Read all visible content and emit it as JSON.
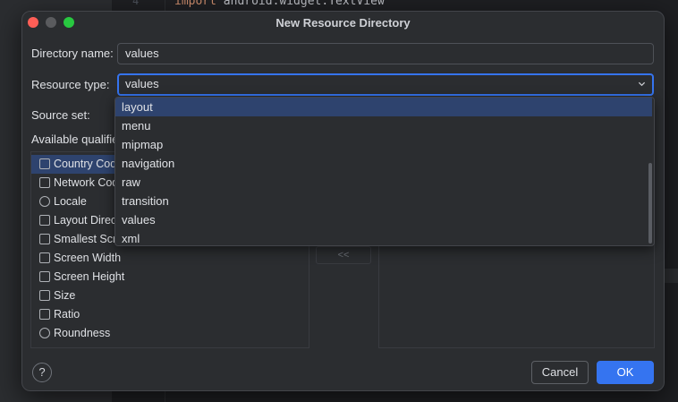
{
  "editor": {
    "line_number": "4",
    "code_keyword": "import",
    "code_rest": " android.widget.TextView"
  },
  "dialog": {
    "title": "New Resource Directory",
    "directory_name_label": "Directory name:",
    "directory_name_value": "values",
    "resource_type_label": "Resource type:",
    "resource_type_value": "values",
    "source_set_label": "Source set:",
    "available_qualifiers_label": "Available qualifier",
    "qualifiers": [
      {
        "label": "Country Cod",
        "icon": "country-code-icon"
      },
      {
        "label": "Network Cod",
        "icon": "network-code-icon"
      },
      {
        "label": "Locale",
        "icon": "globe-icon"
      },
      {
        "label": "Layout Direct",
        "icon": "layout-direction-icon"
      },
      {
        "label": "Smallest Scre",
        "icon": "smallest-screen-icon"
      },
      {
        "label": "Screen Width",
        "icon": "screen-width-icon"
      },
      {
        "label": "Screen Height",
        "icon": "screen-height-icon"
      },
      {
        "label": "Size",
        "icon": "size-icon"
      },
      {
        "label": "Ratio",
        "icon": "ratio-icon"
      },
      {
        "label": "Roundness",
        "icon": "roundness-icon"
      }
    ],
    "remove_button_label": "<<",
    "help_label": "?",
    "cancel_label": "Cancel",
    "ok_label": "OK"
  },
  "dropdown": {
    "options": [
      "layout",
      "menu",
      "mipmap",
      "navigation",
      "raw",
      "transition",
      "values",
      "xml"
    ],
    "highlighted": "layout"
  },
  "colors": {
    "accent": "#3574f0",
    "selection": "#2e436e",
    "close": "#ff5f57",
    "zoom": "#28c840"
  }
}
